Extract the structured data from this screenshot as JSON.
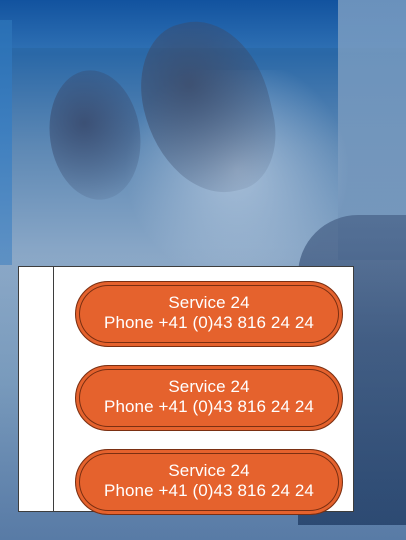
{
  "service_pills": [
    {
      "line1": "Service 24",
      "line2": "Phone +41 (0)43 816 24 24"
    },
    {
      "line1": "Service 24",
      "line2": "Phone +41 (0)43 816 24 24"
    },
    {
      "line1": "Service 24",
      "line2": "Phone +41 (0)43 816 24 24"
    }
  ],
  "colors": {
    "pill_fill": "#e5622d",
    "pill_stroke": "#7a2f12",
    "card_bg": "#ffffff",
    "card_border": "#3d3d3d"
  }
}
